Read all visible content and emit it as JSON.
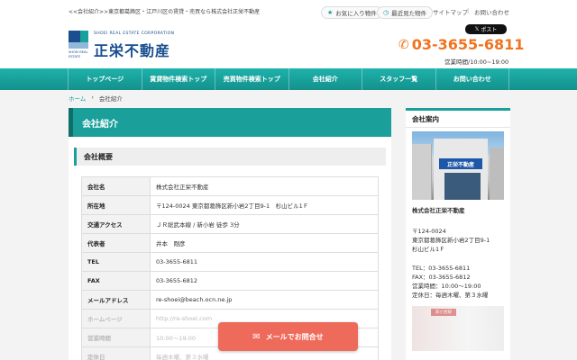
{
  "header": {
    "tagline": "<<会社紹介>>東京都葛飾区・江戸川区の賃貸・売買なら株式会社正栄不動産",
    "favorites": "お気に入り物件",
    "recent": "最近見た物件",
    "sitemap": "サイトマップ",
    "separator": "|",
    "contact": "お問い合わせ",
    "tweet": "ポスト",
    "logo_en": "SHOEI REAL ESTATE CORPORATION",
    "logo_jp": "正栄不動産",
    "logo_sub": "SHOEI REAL ESTATE",
    "phone": "03-3655-6811",
    "hours": "営業時間/10:00~19:00"
  },
  "nav": {
    "items": [
      {
        "label": "トップページ"
      },
      {
        "label": "賃貸物件検索トップ"
      },
      {
        "label": "売買物件検索トップ"
      },
      {
        "label": "会社紹介"
      },
      {
        "label": "スタッフ一覧"
      },
      {
        "label": "お問い合わせ"
      }
    ]
  },
  "breadcrumb": {
    "home": "ホーム",
    "sep": "›",
    "current": "会社紹介"
  },
  "main": {
    "title": "会社紹介",
    "section": "会社概要",
    "rows": [
      {
        "key": "会社名",
        "value": "株式会社正栄不動産"
      },
      {
        "key": "所在地",
        "value": "〒124-0024 東京都葛飾区新小岩2丁目9-1　杉山ビル1Ｆ"
      },
      {
        "key": "交通アクセス",
        "value": "ＪＲ総武本線 / 新小岩 徒歩 3分"
      },
      {
        "key": "代表者",
        "value": "井本　剛彦"
      },
      {
        "key": "TEL",
        "value": "03-3655-6811"
      },
      {
        "key": "FAX",
        "value": "03-3655-6812"
      },
      {
        "key": "メールアドレス",
        "value": "re-shoei@beach.ocn.ne.jp"
      },
      {
        "key": "ホームページ",
        "value": "http://re-shoei.com"
      },
      {
        "key": "営業時間",
        "value": "10:00～19:00"
      },
      {
        "key": "定休日",
        "value": "毎週木曜、第３水曜"
      }
    ]
  },
  "side": {
    "title": "会社案内",
    "photo_sign": "正栄不動産",
    "name": "株式会社正栄不動産",
    "zip": "〒124-0024",
    "addr1": "東京都葛飾区新小岩2丁目9-1",
    "addr2": "杉山ビル1Ｆ",
    "tel": "TEL：03-3655-6811",
    "fax": "FAX：03-3655-6812",
    "hours": "営業時間：10:00～19:00",
    "holiday": "定休日：毎週木曜、第３水曜",
    "badge": "新小岩駅"
  },
  "cta": {
    "label": "メールでお問合せ"
  },
  "icons": {
    "fav": "star-icon",
    "recent": "clock-icon",
    "phone": "phone-icon",
    "mail": "mail-icon",
    "x": "x-logo-icon"
  },
  "colors": {
    "accent": "#1a9f9a",
    "brand": "#1a4e8f",
    "phone": "#f07320",
    "cta": "#ee6a5a"
  }
}
